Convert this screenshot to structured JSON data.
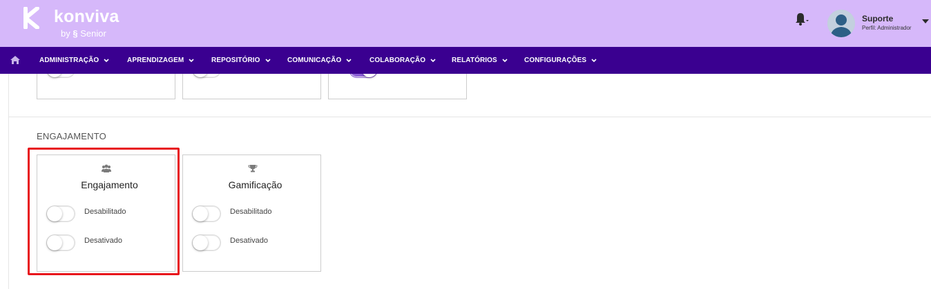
{
  "brand": {
    "name": "konviva",
    "byline": "by",
    "byline_brand": "Senior",
    "header_color": "#d6b8fa",
    "nav_color": "#3a0090"
  },
  "user": {
    "name": "Suporte",
    "role": "Perfil: Administrador"
  },
  "nav": {
    "items": [
      {
        "label": "ADMINISTRAÇÃO"
      },
      {
        "label": "APRENDIZAGEM"
      },
      {
        "label": "REPOSITÓRIO"
      },
      {
        "label": "COMUNICAÇÃO"
      },
      {
        "label": "COLABORAÇÃO"
      },
      {
        "label": "RELATÓRIOS"
      },
      {
        "label": "CONFIGURAÇÕES"
      }
    ]
  },
  "top_cards": [
    {
      "toggle_on": false
    },
    {
      "toggle_on": false
    },
    {
      "toggle_on": true
    }
  ],
  "section": {
    "title": "ENGAJAMENTO",
    "cards": [
      {
        "icon": "users-icon",
        "title": "Engajamento",
        "toggles": [
          {
            "label": "Desabilitado",
            "on": false
          },
          {
            "label": "Desativado",
            "on": false
          }
        ]
      },
      {
        "icon": "trophy-icon",
        "title": "Gamificação",
        "toggles": [
          {
            "label": "Desabilitado",
            "on": false
          },
          {
            "label": "Desativado",
            "on": false
          }
        ]
      }
    ]
  },
  "highlight_color": "#e8141b"
}
